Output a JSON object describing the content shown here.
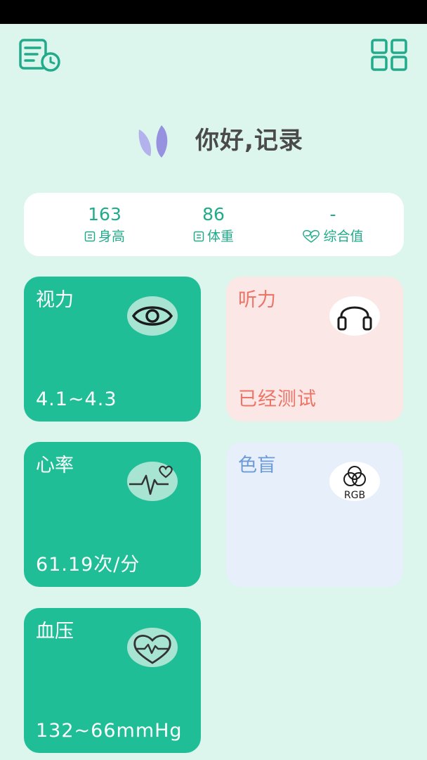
{
  "greeting": "你好,记录",
  "stats": [
    {
      "value": "163",
      "label": "身高",
      "icon": "ruler-icon"
    },
    {
      "value": "86",
      "label": "体重",
      "icon": "scale-icon"
    },
    {
      "value": "-",
      "label": "综合值",
      "icon": "heart-pulse-icon"
    }
  ],
  "tiles": {
    "vision": {
      "title": "视力",
      "value": "4.1~4.3",
      "icon": "eye-icon"
    },
    "hearing": {
      "title": "听力",
      "value": "已经测试",
      "icon": "headphones-icon"
    },
    "heart_rate": {
      "title": "心率",
      "value": "61.19次/分",
      "icon": "heart-rate-icon"
    },
    "color_blind": {
      "title": "色盲",
      "value": "",
      "icon_text": "RGB",
      "icon": "rgb-circles-icon"
    },
    "blood_pressure": {
      "title": "血压",
      "value": "132~66mmHg",
      "icon": "heart-pressure-icon"
    }
  },
  "colors": {
    "accent": "#20be96",
    "background": "#dcf6ee",
    "hearing_bg": "#fbe8e6",
    "hearing_text": "#ee7467",
    "colorblind_bg": "#e7effa",
    "colorblind_text": "#6b9bd9"
  }
}
